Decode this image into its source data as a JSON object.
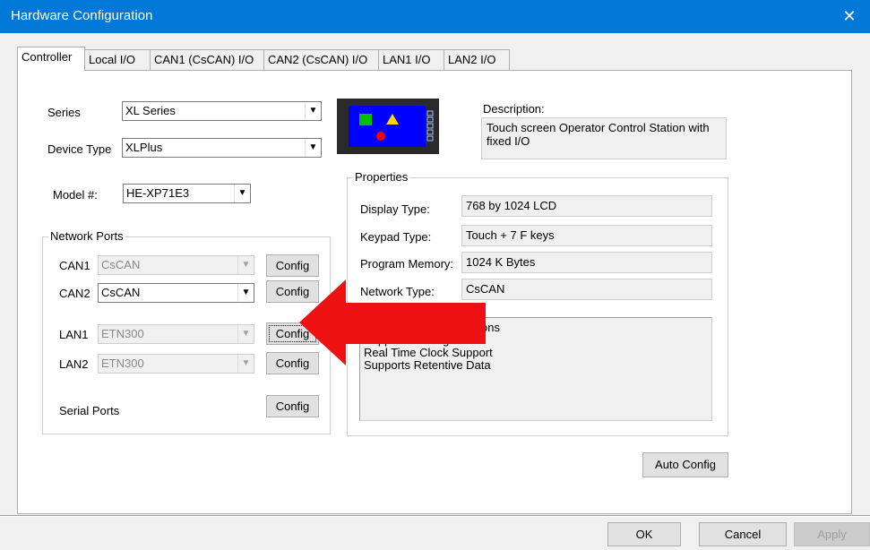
{
  "window": {
    "title": "Hardware Configuration",
    "close_glyph": "✕"
  },
  "tabs": [
    {
      "label": "Controller"
    },
    {
      "label": "Local I/O"
    },
    {
      "label": "CAN1 (CsCAN) I/O"
    },
    {
      "label": "CAN2 (CsCAN) I/O"
    },
    {
      "label": "LAN1 I/O"
    },
    {
      "label": "LAN2 I/O"
    }
  ],
  "controller": {
    "series_label": "Series",
    "series_value": "XL Series",
    "device_type_label": "Device Type",
    "device_type_value": "XLPlus",
    "model_label": "Model #:",
    "model_value": "HE-XP71E3",
    "network_ports": {
      "group_label": "Network Ports",
      "can1_label": "CAN1",
      "can1_value": "CsCAN",
      "can2_label": "CAN2",
      "can2_value": "CsCAN",
      "lan1_label": "LAN1",
      "lan1_value": "ETN300",
      "lan2_label": "LAN2",
      "lan2_value": "ETN300",
      "serial_label": "Serial Ports",
      "config_label": "Config"
    },
    "description_label": "Description:",
    "description_text": "Touch screen Operator Control Station with fixed I/O",
    "properties": {
      "group_label": "Properties",
      "display_type_label": "Display Type:",
      "display_type_value": "768 by 1024 LCD",
      "keypad_type_label": "Keypad Type:",
      "keypad_type_value": "Touch + 7 F keys",
      "program_memory_label": "Program Memory:",
      "program_memory_value": "1024 K Bytes",
      "network_type_label": "Network Type:",
      "network_type_value": "CsCAN",
      "features_partial_first": "ctions",
      "features_partial_second": "Supports Analog Data",
      "features": [
        "Real Time Clock Support",
        "Supports Retentive Data"
      ]
    },
    "auto_config_label": "Auto Config"
  },
  "footer": {
    "ok_label": "OK",
    "cancel_label": "Cancel",
    "apply_label": "Apply"
  },
  "colors": {
    "titlebar": "#0078d7",
    "device_bg": "#0000ff",
    "device_frame": "#2a2a2a",
    "arrow": "#ee1111"
  },
  "icons": {
    "device": "controller-device-icon",
    "arrow": "red-arrow-annotation-icon"
  }
}
